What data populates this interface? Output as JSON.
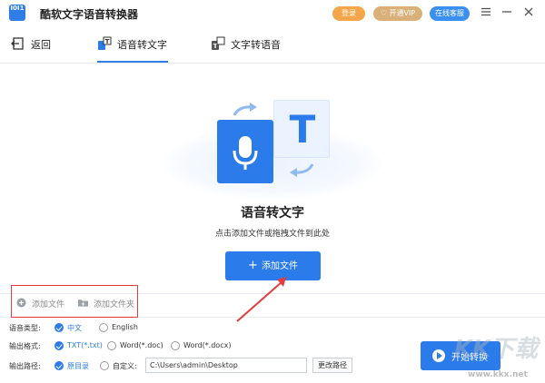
{
  "app": {
    "title": "酷软文字语音转换器",
    "logo_text": "I0I1",
    "login_label": "登录",
    "vip_label": "开通VIP",
    "service_label": "在线客服"
  },
  "tabs": {
    "back_label": "返回",
    "speech_to_text_label": "语音转文字",
    "text_to_speech_label": "文字转语音"
  },
  "hero": {
    "title": "语音转文字",
    "subtitle": "点击添加文件或拖拽文件到此处",
    "add_file_label": "添加文件",
    "t_glyph": "T"
  },
  "add_row": {
    "add_file_label": "添加文件",
    "add_folder_label": "添加文件夹"
  },
  "options": {
    "language": {
      "label": "语音类型:",
      "choices": [
        "中文",
        "English"
      ],
      "selected": "中文"
    },
    "format": {
      "label": "输出格式:",
      "choices": [
        "TXT(*.txt)",
        "Word(*.doc)",
        "Word(*.docx)"
      ],
      "selected": "TXT(*.txt)"
    },
    "path": {
      "label": "输出路径:",
      "choices": [
        "原目录",
        "自定义:"
      ],
      "selected": "原目录",
      "value": "C:\\Users\\admin\\Desktop",
      "change_label": "更改路径"
    }
  },
  "start_label": "开始转换",
  "watermark": {
    "url": "www.kkx.net",
    "logo_text": "KK下载"
  },
  "colors": {
    "accent": "#2b7bea",
    "login": "#f3a74a",
    "vip": "#d9b07a",
    "annotation": "#e23c3c"
  }
}
